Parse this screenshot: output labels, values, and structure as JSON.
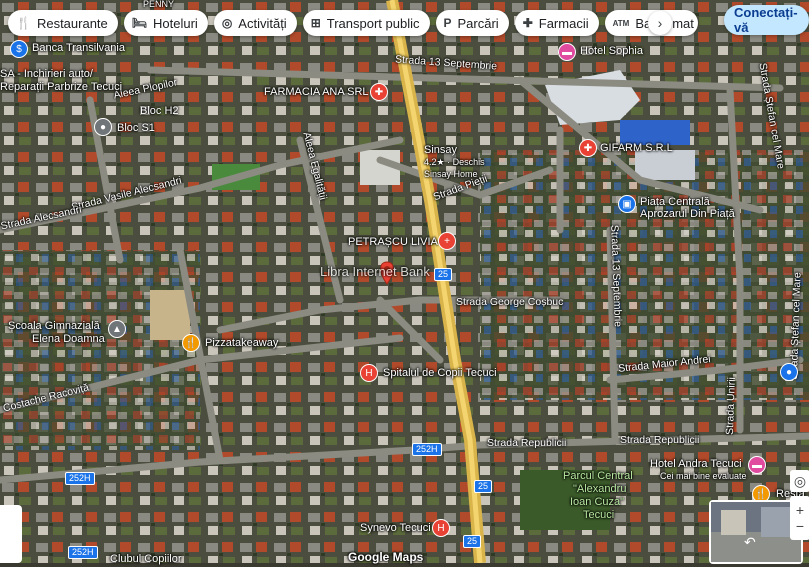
{
  "chips": [
    {
      "icon": "restaurant-icon",
      "glyph": "🍴",
      "label": "Restaurante"
    },
    {
      "icon": "hotel-icon",
      "glyph": "🛏",
      "label": "Hoteluri"
    },
    {
      "icon": "camera-icon",
      "glyph": "◎",
      "label": "Activități"
    },
    {
      "icon": "transit-icon",
      "glyph": "⊞",
      "label": "Transport public"
    },
    {
      "icon": "parking-icon",
      "glyph": "P",
      "label": "Parcări"
    },
    {
      "icon": "pharmacy-icon",
      "glyph": "✚",
      "label": "Farmacii"
    },
    {
      "icon": "atm-icon",
      "glyph": "ATM",
      "label": "Bancomat"
    }
  ],
  "signin": "Conectați-vă",
  "top_clip": "PENNY",
  "streets": {
    "s13sept": "Strada 13 Septembrie",
    "ploplor": "Aleea Plopilor",
    "egalitatii": "Aleea Egalității",
    "vasile": "Strada Vasile Alecsandri",
    "alecsandri": "Strada Alecsandri",
    "pietii": "Strada Pieții",
    "cosbuc": "Strada George Coșbuc",
    "s13sept_v": "Strada 13 Septembrie",
    "maior": "Strada Maior Andrei",
    "republicii_l": "Strada Republicii",
    "republicii_r": "Strada Republicii",
    "unirii": "Strada Unirii",
    "stefan_m": "Strada Ștefan cel Mare",
    "stefan_m2": "Strada Ștefan cel Mare",
    "racovita": "Costache Racoviță"
  },
  "places": {
    "banca": "Banca Transilvania",
    "parbrize1": "SA - Inchirieri auto/",
    "parbrize2": "Reparații Parbrize Tecuci",
    "blocH2": "Bloc H2",
    "blocS1": "Bloc S1",
    "farmacia": "FARMACIA ANA SRL",
    "hotelsophia": "Hotel Sophia",
    "sinsay": "Sinsay",
    "sinsay_rating": "4.2★ · Deschis",
    "sinsay_cat": "Sinsay Home",
    "gifarm": "GIFARM S.R.L",
    "piata1": "Piața Centrală",
    "piata2": "Aprozarul Din Piață",
    "petrascu": "PETRAȘCU LIVIA",
    "libra": "Libra Internet Bank",
    "scoala1": "Școala Gimnazială",
    "scoala2": "Elena Doamna",
    "pizza": "Pizzatakeaway",
    "spital": "Spitalul de Copii Tecuci",
    "hotelandra": "Hotel Andra Tecuci",
    "hotelandra_sub": "Cei mai bine evaluate",
    "parc1": "Parcul Central",
    "parc2": "\"Alexandru",
    "parc3": "Ioan Cuza\"",
    "parc4": "Tecuci",
    "synevo": "Synevo Tecuci",
    "clubul": "Clubul Copiilor",
    "resta": "Resta",
    "logo": "Google Maps"
  },
  "shields": {
    "a": "25",
    "b": "252H",
    "c": "252H",
    "d": "25",
    "e": "25",
    "f": "252H"
  },
  "colors": {
    "accent": "#1a73e8",
    "poi_red": "#e94235",
    "poi_pink": "#e04ba0",
    "poi_orange": "#f29900",
    "poi_gray": "#70757a"
  }
}
